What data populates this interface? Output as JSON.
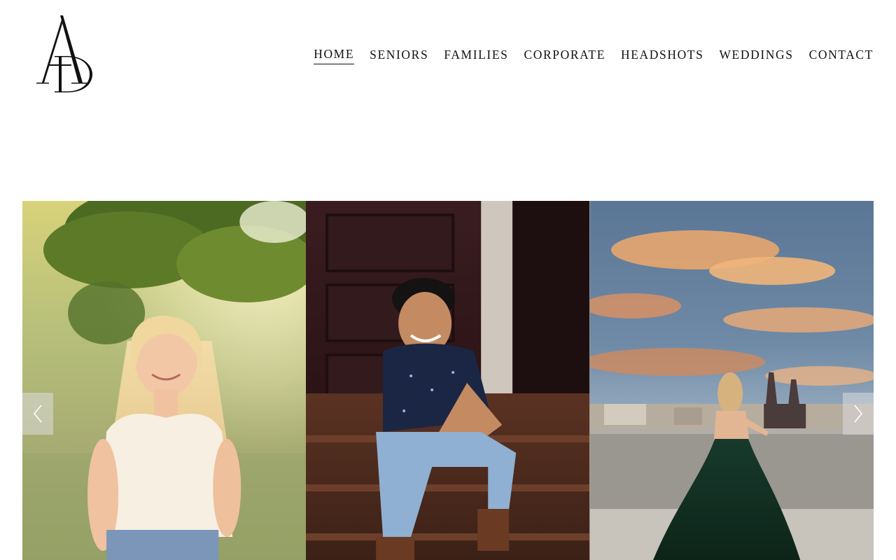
{
  "site": {
    "logo_alt": "AD"
  },
  "nav": {
    "items": [
      {
        "label": "HOME",
        "active": true
      },
      {
        "label": "SENIORS",
        "active": false
      },
      {
        "label": "FAMILIES",
        "active": false
      },
      {
        "label": "CORPORATE",
        "active": false
      },
      {
        "label": "HEADSHOTS",
        "active": false
      },
      {
        "label": "WEDDINGS",
        "active": false
      },
      {
        "label": "CONTACT",
        "active": false
      }
    ]
  },
  "gallery": {
    "slides": [
      {
        "subject": "senior portrait girl in white top in sunlit field"
      },
      {
        "subject": "senior portrait boy seated on wooden steps"
      },
      {
        "subject": "girl in green gown on rooftop at sunset"
      }
    ],
    "prev_icon": "chevron-left-icon",
    "next_icon": "chevron-right-icon"
  },
  "colors": {
    "text": "#111111",
    "background": "#ffffff",
    "arrow_bg": "#dcdcdc"
  }
}
